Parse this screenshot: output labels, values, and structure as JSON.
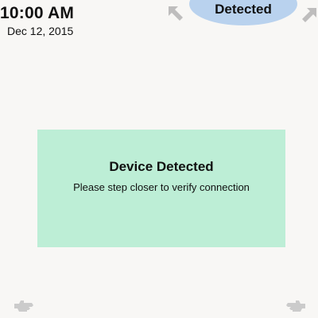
{
  "clock": {
    "time": "10:00 AM",
    "date": "Dec 12, 2015"
  },
  "status": {
    "label": "Detected",
    "color": "#b9d2ee"
  },
  "notification": {
    "title": "Device Detected",
    "message": "Please step closer to verify connection",
    "color": "#bdeed6"
  },
  "icons": {
    "top_left": "arrow-up-left-icon",
    "top_right": "arrow-up-right-icon",
    "bottom_left": "hand-gesture-left-icon",
    "bottom_right": "hand-gesture-right-icon"
  }
}
